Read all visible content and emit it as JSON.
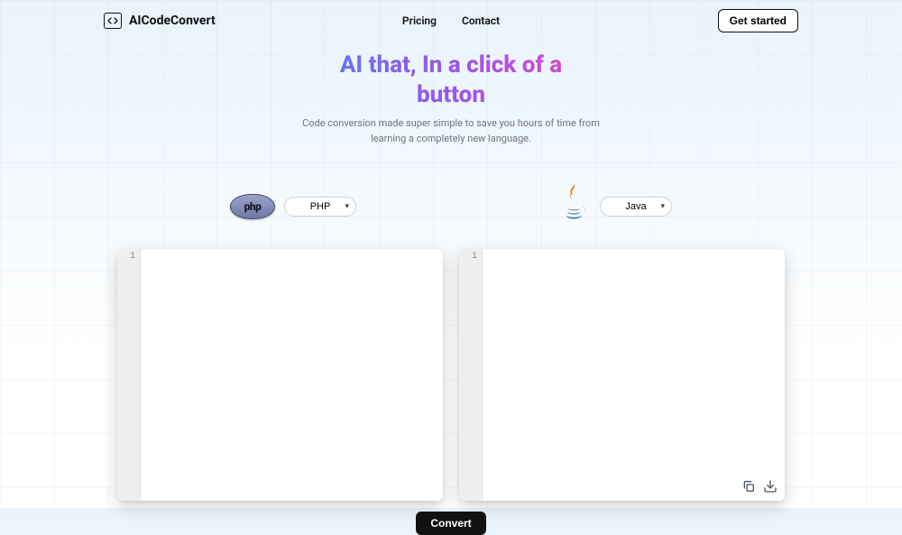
{
  "header": {
    "brand": "AICodeConvert",
    "nav": {
      "pricing": "Pricing",
      "contact": "Contact"
    },
    "cta": "Get started"
  },
  "hero": {
    "title": "AI that, In a click of a button",
    "subtitle": "Code conversion made super simple to save you hours of time from learning a completely new language."
  },
  "languages": {
    "source": {
      "icon_label": "php",
      "selected": "PHP"
    },
    "target": {
      "icon_name": "java",
      "selected": "Java"
    }
  },
  "editors": {
    "source": {
      "line_number": "1"
    },
    "target": {
      "line_number": "1"
    }
  },
  "actions": {
    "convert": "Convert"
  },
  "icons": {
    "copy": "copy-icon",
    "download": "download-icon"
  }
}
